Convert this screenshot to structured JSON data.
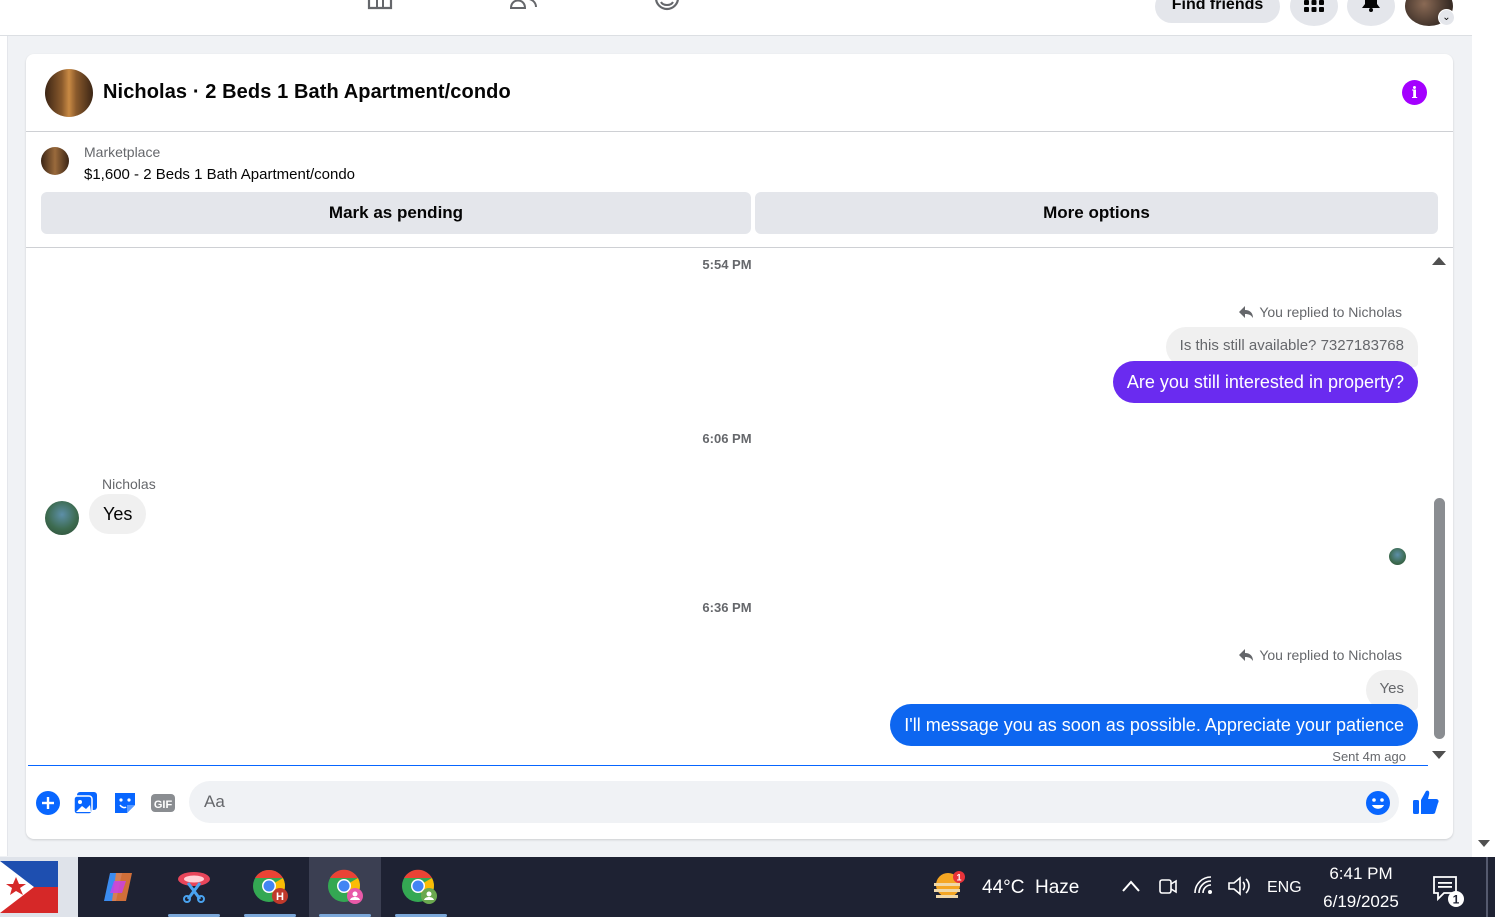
{
  "topnav": {
    "find_friends_label": "Find friends"
  },
  "chat": {
    "title": "Nicholas · 2 Beds 1 Bath Apartment/condo",
    "listing": {
      "label": "Marketplace",
      "price_title": "$1,600 - 2 Beds 1 Bath Apartment/condo"
    },
    "buttons": {
      "mark_pending": "Mark as pending",
      "more_options": "More options"
    },
    "messages": {
      "time1": "5:54 PM",
      "reply1_label": "You replied to Nicholas",
      "reply1_quote": "Is this still available? 7327183768",
      "reply1_text": "Are you still interested in property?",
      "time2": "6:06 PM",
      "incoming_sender": "Nicholas",
      "incoming_text": "Yes",
      "time3": "6:36 PM",
      "reply2_label": "You replied to Nicholas",
      "reply2_quote": "Yes",
      "reply2_text": "I'll message you as soon as possible. Appreciate your patience",
      "sent_status": "Sent 4m ago"
    },
    "composer": {
      "placeholder": "Aa"
    },
    "colors": {
      "accent_purple": "#6a2bf0",
      "accent_blue": "#0d66f0",
      "info_purple": "#a400ff"
    }
  },
  "taskbar": {
    "weather_badge": "1",
    "weather": "44°C  Haze",
    "language": "ENG",
    "time": "6:41 PM",
    "date": "6/19/2025",
    "notification_count": "1",
    "chrome_profile_letter": "H"
  }
}
